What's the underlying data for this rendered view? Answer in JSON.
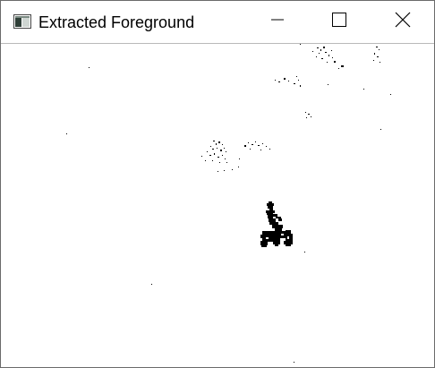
{
  "window": {
    "title": "Extracted Foreground",
    "controls": {
      "minimize": "minimize",
      "maximize": "maximize",
      "close": "close"
    }
  },
  "icons": {
    "app": "app-window-icon",
    "minimize": "minimize-icon",
    "maximize": "maximize-icon",
    "close": "close-icon"
  },
  "colors": {
    "foreground_pixels": "#000000",
    "background": "#ffffff",
    "window_border": "#6b6b6b"
  }
}
